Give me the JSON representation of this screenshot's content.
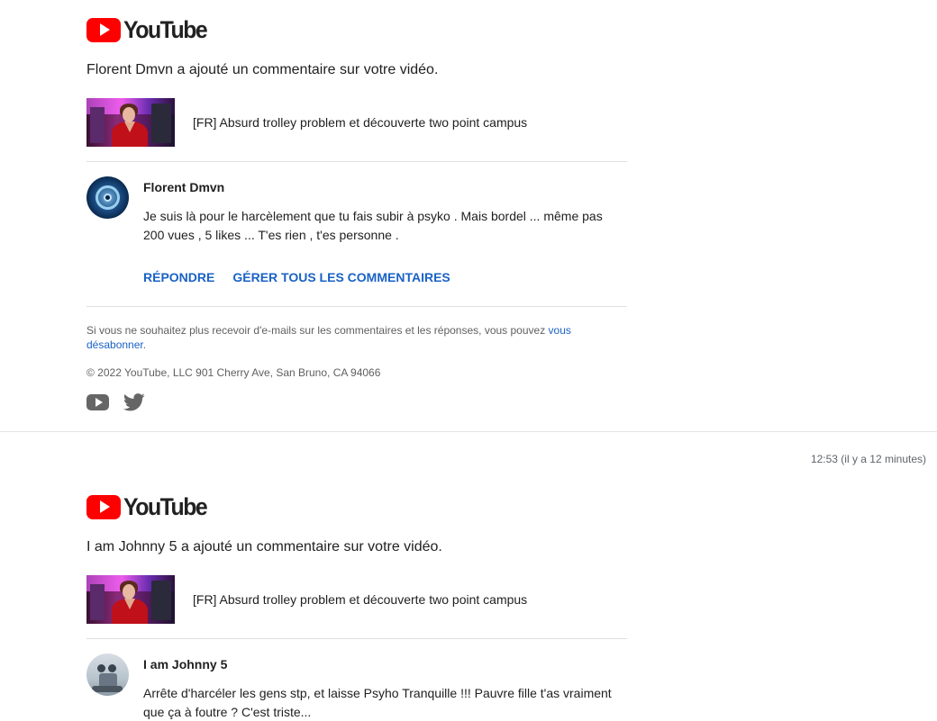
{
  "emails": [
    {
      "logo_text": "YouTube",
      "headline": "Florent Dmvn a ajouté un commentaire sur votre vidéo.",
      "video_title": "[FR] Absurd trolley problem et découverte two point campus",
      "comment": {
        "author": "Florent Dmvn",
        "text_line1": "Je suis là pour le harcèlement que tu fais subir à psyko . Mais bordel ... même pas",
        "text_line2": "200 vues , 5 likes ... T'es rien , t'es personne ."
      },
      "actions": {
        "reply": "RÉPONDRE",
        "manage": "GÉRER TOUS LES COMMENTAIRES"
      },
      "footer": {
        "unsubscribe_text": "Si vous ne souhaitez plus recevoir d'e-mails sur les commentaires et les réponses, vous pouvez ",
        "unsubscribe_link": "vous désabonner",
        "unsubscribe_end": ".",
        "copyright": "© 2022 YouTube, LLC 901 Cherry Ave, San Bruno, CA 94066"
      }
    },
    {
      "logo_text": "YouTube",
      "headline": "I am Johnny 5 a ajouté un commentaire sur votre vidéo.",
      "video_title": "[FR] Absurd trolley problem et découverte two point campus",
      "comment": {
        "author": "I am Johnny 5",
        "text_line1": "Arrête d'harcéler les gens stp, et laisse Psyho Tranquille !!! Pauvre fille t'as vraiment",
        "text_line2": "que ça à foutre ? C'est triste..."
      }
    }
  ],
  "timestamp": "12:53 (il y a 12 minutes)",
  "icons": {
    "youtube_logo": "youtube-logo-icon",
    "footer_youtube": "youtube-icon",
    "footer_twitter": "twitter-icon"
  },
  "colors": {
    "brand_red": "#ff0000",
    "link_blue": "#1a62c5",
    "text": "#212121",
    "muted": "#606060"
  }
}
